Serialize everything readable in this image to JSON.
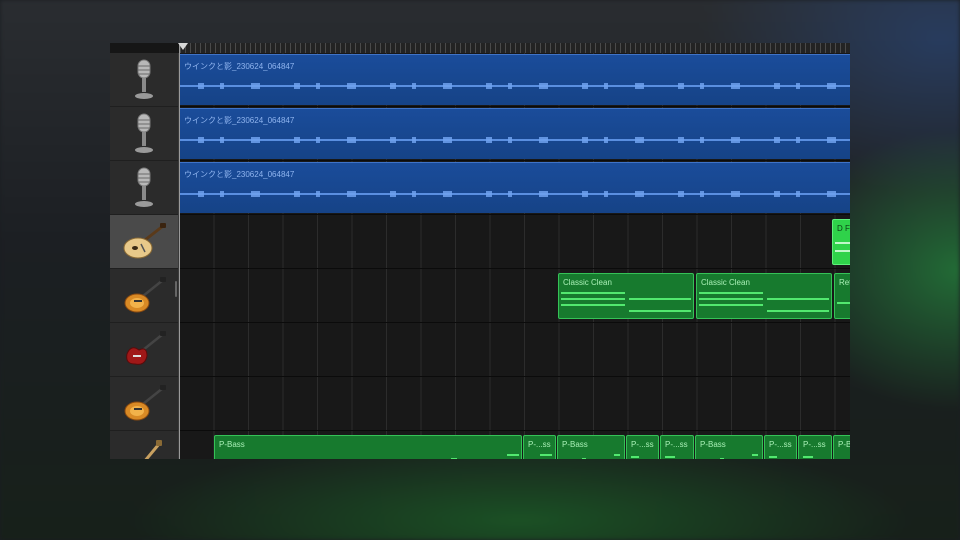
{
  "timeline": {
    "ruler_label": ""
  },
  "tracks": [
    {
      "id": "track-1",
      "type": "audio",
      "instrument": "microphone",
      "icon": "microphone-icon",
      "region_name": "ウインクと影_230624_064847"
    },
    {
      "id": "track-2",
      "type": "audio",
      "instrument": "microphone",
      "icon": "microphone-icon",
      "region_name": "ウインクと影_230624_064847"
    },
    {
      "id": "track-3",
      "type": "audio",
      "instrument": "microphone",
      "icon": "microphone-icon",
      "region_name": "ウインクと影_230624_064847"
    },
    {
      "id": "track-4",
      "type": "midi",
      "instrument": "hollow-body-guitar",
      "icon": "hollow-body-guitar-icon",
      "selected": true,
      "regions": [
        {
          "name": "D F"
        }
      ]
    },
    {
      "id": "track-5",
      "type": "midi",
      "instrument": "sunburst-electric-guitar",
      "icon": "electric-guitar-icon",
      "regions": [
        {
          "name": "Classic Clean"
        },
        {
          "name": "Classic Clean"
        },
        {
          "name": "Ret"
        }
      ]
    },
    {
      "id": "track-6",
      "type": "midi",
      "instrument": "red-electric-guitar",
      "icon": "red-electric-guitar-icon",
      "regions": []
    },
    {
      "id": "track-7",
      "type": "midi",
      "instrument": "sunburst-electric-guitar",
      "icon": "electric-guitar-icon",
      "regions": []
    },
    {
      "id": "track-8",
      "type": "midi",
      "instrument": "bass-guitar",
      "icon": "bass-guitar-icon",
      "regions": [
        {
          "name": "P-Bass"
        },
        {
          "name": "P-...ss"
        },
        {
          "name": "P-Bass"
        },
        {
          "name": "P-...ss"
        },
        {
          "name": "P-...ss"
        },
        {
          "name": "P-Bass"
        },
        {
          "name": "P-...ss"
        },
        {
          "name": "P-...ss"
        },
        {
          "name": "P-B"
        }
      ]
    }
  ],
  "colors": {
    "audio_region": "#1a4c9a",
    "midi_region": "#177a2e",
    "midi_region_selected": "#2fd24a",
    "header_bg": "#2b2b2b",
    "header_selected": "#4a4a4a"
  }
}
